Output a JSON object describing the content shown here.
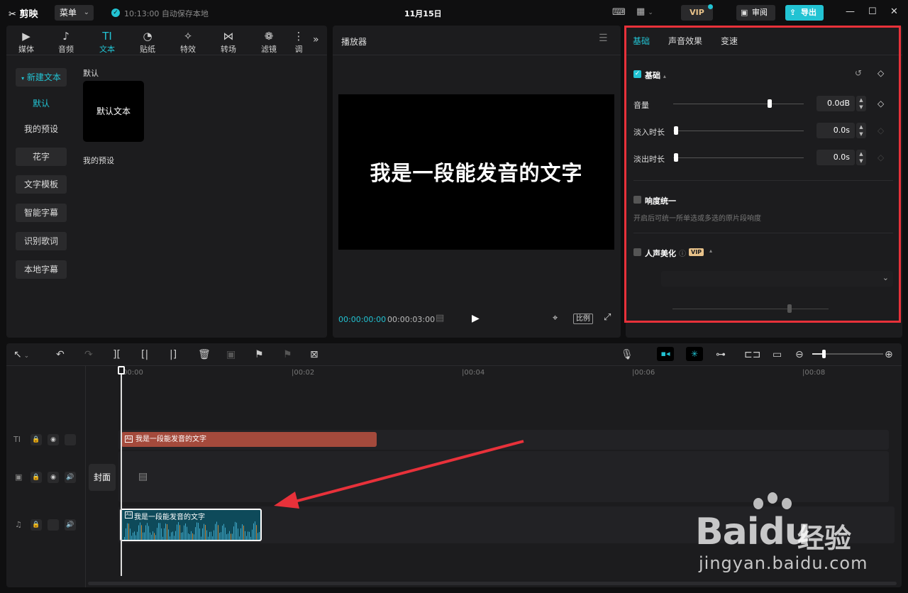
{
  "app": {
    "name": "剪映",
    "menu_label": "菜单",
    "save_status": "10:13:00 自动保存本地",
    "project_title": "11月15日"
  },
  "topbar": {
    "vip_label": "VIP",
    "review_label": "审阅",
    "export_label": "导出"
  },
  "tools": [
    {
      "label": "媒体",
      "icon": "▶"
    },
    {
      "label": "音频",
      "icon": "♪"
    },
    {
      "label": "文本",
      "icon": "TI"
    },
    {
      "label": "贴纸",
      "icon": "◔"
    },
    {
      "label": "特效",
      "icon": "✧"
    },
    {
      "label": "转场",
      "icon": "⋈"
    },
    {
      "label": "滤镜",
      "icon": "❁"
    },
    {
      "label": "调",
      "icon": "⋮"
    }
  ],
  "sidebar": {
    "items": [
      "新建文本",
      "默认",
      "我的预设",
      "花字",
      "文字模板",
      "智能字幕",
      "识别歌词",
      "本地字幕"
    ]
  },
  "content": {
    "section_default": "默认",
    "preset_card": "默认文本",
    "section_mine": "我的预设"
  },
  "player": {
    "title": "播放器",
    "screen_text": "我是一段能发音的文字",
    "time_current": "00:00:00:00",
    "time_total": "00:00:03:00",
    "ratio_label": "比例"
  },
  "right_panel": {
    "tabs": [
      "基础",
      "声音效果",
      "变速"
    ],
    "basic_header": "基础",
    "volume_label": "音量",
    "volume_value": "0.0dB",
    "fade_in_label": "淡入时长",
    "fade_in_value": "0.0s",
    "fade_out_label": "淡出时长",
    "fade_out_value": "0.0s",
    "loudness_label": "响度统一",
    "loudness_hint": "开启后可统一所单选或多选的原片段响度",
    "voice_label": "人声美化",
    "voice_badge": "VIP"
  },
  "timeline": {
    "ticks": [
      "00:00",
      "00:02",
      "00:04",
      "00:06",
      "00:08"
    ],
    "cover_label": "封面",
    "text_clip_label": "我是一段能发音的文字",
    "audio_clip_label": "我是一段能发音的文字",
    "text_track_label": "TI"
  },
  "watermark": {
    "brand": "Bai",
    "brand_du": "du",
    "suffix": "经验",
    "url": "jingyan.baidu.com"
  }
}
